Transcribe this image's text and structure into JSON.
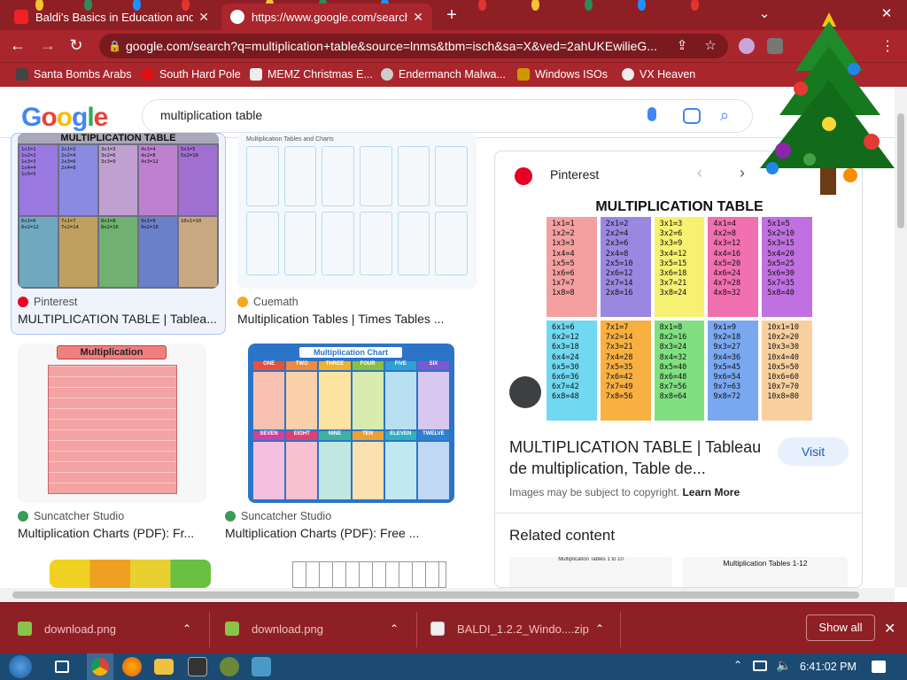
{
  "tabs": [
    {
      "title": "Baldi's Basics in Education and Le",
      "active": false
    },
    {
      "title": "https://www.google.com/search?",
      "active": true
    }
  ],
  "address_bar": {
    "url": "google.com/search?q=multiplication+table&source=lnms&tbm=isch&sa=X&ved=2ahUKEwilieG..."
  },
  "bookmarks": [
    "Santa Bombs Arabs",
    "South Hard Pole",
    "MEMZ Christmas E...",
    "Endermanch Malwa...",
    "Windows ISOs",
    "VX Heaven"
  ],
  "google": {
    "logo": "Google",
    "query": "multiplication table"
  },
  "results": [
    {
      "source": "Pinterest",
      "title": "MULTIPLICATION TABLE | Tablea..."
    },
    {
      "source": "Cuemath",
      "title": "Multiplication Tables | Times Tables ..."
    },
    {
      "source": "Suncatcher Studio",
      "title": "Multiplication Charts (PDF): Fr...",
      "thumb_label": "Multiplication"
    },
    {
      "source": "Suncatcher Studio",
      "title": "Multiplication Charts (PDF): Free ...",
      "thumb_label": "Multiplication Chart"
    }
  ],
  "thumb_texts": {
    "r1_header": "MULTIPLICATION TABLE",
    "r2_header": "Multiplication Tables and Charts",
    "chart_cols": [
      "ONE",
      "TWO",
      "THREE",
      "FOUR",
      "FIVE",
      "SIX"
    ],
    "chart_cols2": [
      "SEVEN",
      "EIGHT",
      "NINE",
      "TEN",
      "ELEVEN",
      "TWELVE"
    ]
  },
  "panel": {
    "source": "Pinterest",
    "image_title": "MULTIPLICATION TABLE",
    "title": "MULTIPLICATION TABLE | Tableau de multiplication, Table de...",
    "title_line1": "MULTIPLICATION TABLE | Tableau",
    "title_line2": "de multiplication, Table de...",
    "copyright": "Images may be subject to copyright.",
    "learn_more": "Learn More",
    "visit": "Visit",
    "related": "Related content",
    "related_thumb2": "Multiplication Tables 1-12",
    "related_thumb1": "Multiplication Tables 1 to 10"
  },
  "downloads": [
    {
      "name": "download.png"
    },
    {
      "name": "download.png"
    },
    {
      "name": "BALDI_1.2.2_Windo....zip"
    }
  ],
  "show_all": "Show all",
  "clock": "6:41:02 PM",
  "colors": {
    "chrome_dark": "#8e1f25",
    "chrome": "#a9262c",
    "taskbar": "#1b4a73",
    "link_blue": "#1a5fb4"
  },
  "icons": [
    "search-icon",
    "mic-icon",
    "lens-icon",
    "lock-icon",
    "star-icon",
    "share-icon",
    "close-icon",
    "chevron-up-icon"
  ]
}
